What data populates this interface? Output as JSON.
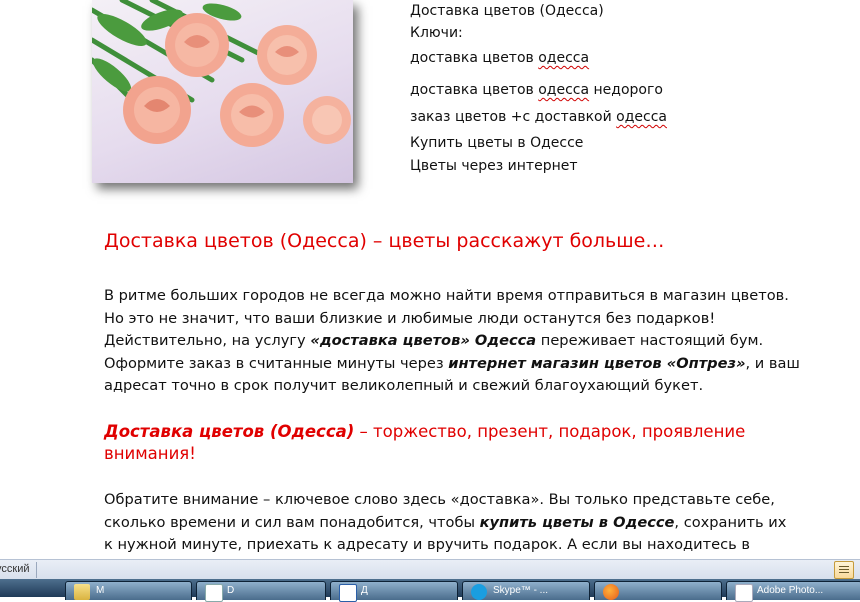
{
  "image": {
    "alt": "roses"
  },
  "keywords": {
    "title": "Доставка цветов (Одесса)",
    "label": "Ключи:",
    "k1_a": "доставка цветов ",
    "k1_b": "одесса",
    "k2_a": "доставка цветов ",
    "k2_b": "одесса",
    "k2_c": " недорого",
    "k3_a": "заказ цветов +с доставкой ",
    "k3_b": "одесса",
    "k4": "Купить цветы в Одессе",
    "k5": "Цветы через интернет"
  },
  "article": {
    "heading": "Доставка цветов (Одесса) – цветы расскажут больше…",
    "p1": {
      "l1": "В ритме больших городов не всегда можно найти время отправиться в магазин цветов.",
      "l2": "Но это не значит, что ваши близкие и любимые люди останутся без подарков!",
      "l3_a": "Действительно, на услугу ",
      "l3_b": "«доставка цветов» Одесса",
      "l3_c": " переживает настоящий бум.",
      "l4_a": "Оформите заказ в считанные  минуты через ",
      "l4_b": "интернет магазин цветов «Оптрез»",
      "l4_c": ", и ваш",
      "l5": "адресат точно в срок получит великолепный и свежий благоухающий букет."
    },
    "sub": {
      "l1_a": "Доставка цветов (Одесса)",
      "l1_b": " – торжество, презент, подарок, проявление",
      "l2": "внимания!"
    },
    "p2": {
      "l1": "Обратите внимание – ключевое слово здесь «доставка». Вы только представьте себе,",
      "l2_a": "сколько времени и сил вам понадобится, чтобы ",
      "l2_b": "купить цветы в Одессе",
      "l2_c": ", сохранить их",
      "l3": "к нужной минуте, приехать к адресату и вручить подарок. А если вы находитесь в"
    }
  },
  "statusbar": {
    "language": "усский"
  },
  "taskbar": {
    "items": [
      {
        "icon": "folder-icon",
        "label": "M"
      },
      {
        "icon": "document-icon",
        "label": "D"
      },
      {
        "icon": "word-icon",
        "label": "Д"
      },
      {
        "icon": "skype-icon",
        "label": "Skype™ - ..."
      },
      {
        "icon": "firefox-icon",
        "label": ""
      },
      {
        "icon": "acrobat-icon",
        "label": "Adobe Photo..."
      }
    ]
  },
  "colors": {
    "heading": "#e00000",
    "spell_underline": "#d00000",
    "taskbar": "#1f3a57"
  }
}
